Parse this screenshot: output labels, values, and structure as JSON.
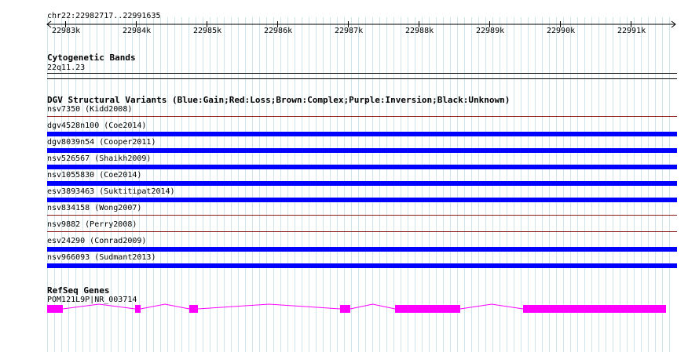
{
  "ruler": {
    "location": "chr22:22982717..22991635",
    "ticks": [
      "22983k",
      "22984k",
      "22985k",
      "22986k",
      "22987k",
      "22988k",
      "22989k",
      "22990k",
      "22991k"
    ]
  },
  "cytoband": {
    "title": "Cytogenetic Bands",
    "band_label": "22q11.23"
  },
  "dgv": {
    "title": "DGV Structural Variants (Blue:Gain;Red:Loss;Brown:Complex;Purple:Inversion;Black:Unknown)",
    "variants": [
      {
        "label": "nsv7350 (Kidd2008)",
        "color": "#8b1a1a",
        "type": "complex"
      },
      {
        "label": "dgv4528n100 (Coe2014)",
        "color": "#0000ff",
        "type": "gain"
      },
      {
        "label": "dgv8039n54 (Cooper2011)",
        "color": "#0000ff",
        "type": "gain"
      },
      {
        "label": "nsv526567 (Shaikh2009)",
        "color": "#0000ff",
        "type": "gain"
      },
      {
        "label": "nsv1055830 (Coe2014)",
        "color": "#0000ff",
        "type": "gain"
      },
      {
        "label": "esv3893463 (Suktitipat2014)",
        "color": "#0000ff",
        "type": "gain"
      },
      {
        "label": "nsv834158 (Wong2007)",
        "color": "#8b1a1a",
        "type": "complex"
      },
      {
        "label": "nsv9882 (Perry2008)",
        "color": "#8b1a1a",
        "type": "complex"
      },
      {
        "label": "esv24290 (Conrad2009)",
        "color": "#0000ff",
        "type": "gain"
      },
      {
        "label": "nsv966093 (Sudmant2013)",
        "color": "#0000ff",
        "type": "gain"
      }
    ]
  },
  "refseq": {
    "title": "RefSeq Genes",
    "gene_label": "POM121L9P|NR_003714",
    "gene_color": "#ff00ff"
  }
}
